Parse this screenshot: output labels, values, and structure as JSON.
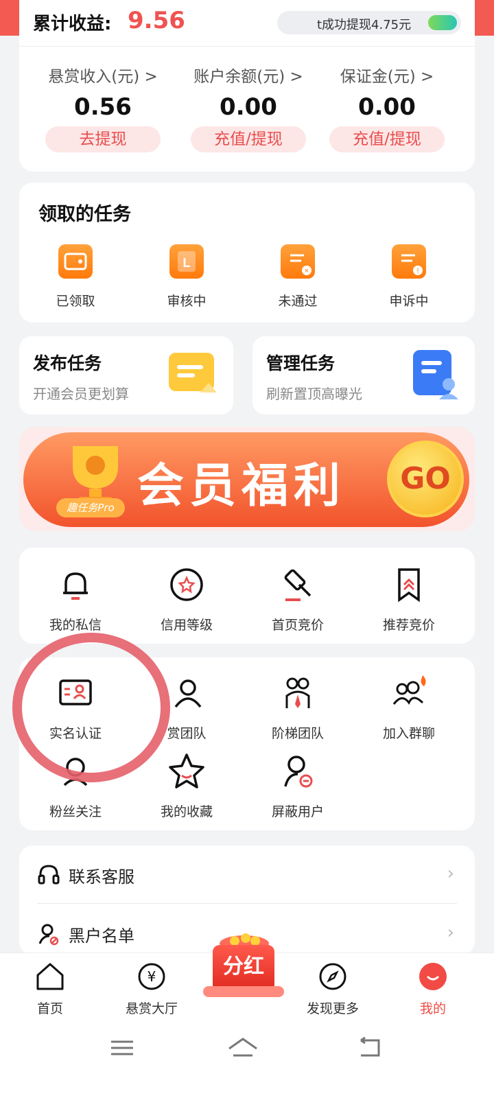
{
  "earnings": {
    "title": "累计收益:",
    "value": "9.56",
    "ticker": "t成功提现4.75元"
  },
  "stats": [
    {
      "label": "悬赏收入(元) >",
      "value": "0.56",
      "button": "去提现"
    },
    {
      "label": "账户余额(元) >",
      "value": "0.00",
      "button": "充值/提现"
    },
    {
      "label": "保证金(元) >",
      "value": "0.00",
      "button": "充值/提现"
    }
  ],
  "tasks": {
    "title": "领取的任务",
    "items": [
      {
        "label": "已领取",
        "icon": "wallet-icon"
      },
      {
        "label": "审核中",
        "icon": "reviewing-icon"
      },
      {
        "label": "未通过",
        "icon": "rejected-icon"
      },
      {
        "label": "申诉中",
        "icon": "appeal-icon"
      }
    ]
  },
  "publish": {
    "title": "发布任务",
    "subtitle": "开通会员更划算"
  },
  "manage": {
    "title": "管理任务",
    "subtitle": "刷新置顶高曝光"
  },
  "banner": {
    "text": "会员福利",
    "go": "GO",
    "badge": "趣任务Pro"
  },
  "grid1": [
    {
      "label": "我的私信",
      "icon": "bell-icon"
    },
    {
      "label": "信用等级",
      "icon": "star-badge-icon"
    },
    {
      "label": "首页竞价",
      "icon": "gavel-icon"
    },
    {
      "label": "推荐竞价",
      "icon": "bookmark-icon"
    }
  ],
  "grid2": [
    {
      "label": "实名认证",
      "icon": "id-card-icon"
    },
    {
      "label": "赏团队",
      "icon": "user-icon"
    },
    {
      "label": "阶梯团队",
      "icon": "team-icon"
    },
    {
      "label": "加入群聊",
      "icon": "group-chat-icon"
    },
    {
      "label": "粉丝关注",
      "icon": "fans-icon"
    },
    {
      "label": "我的收藏",
      "icon": "favorite-star-icon"
    },
    {
      "label": "屏蔽用户",
      "icon": "block-user-icon"
    }
  ],
  "list": [
    {
      "label": "联系客服",
      "icon": "headset-icon"
    },
    {
      "label": "黑户名单",
      "icon": "blacklist-icon"
    }
  ],
  "nav": [
    {
      "label": "首页",
      "icon": "home-icon"
    },
    {
      "label": "悬赏大厅",
      "icon": "yen-icon"
    },
    {
      "label": "分红",
      "icon": "dividend-icon"
    },
    {
      "label": "发现更多",
      "icon": "compass-icon"
    },
    {
      "label": "我的",
      "icon": "profile-icon"
    }
  ],
  "colors": {
    "accent": "#ef5350",
    "orange": "#ff7a0c",
    "pinkBg": "#fde6e6"
  }
}
